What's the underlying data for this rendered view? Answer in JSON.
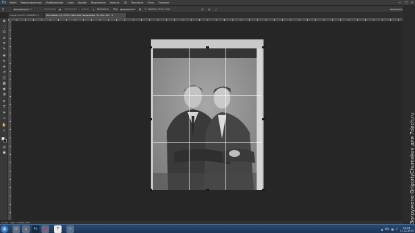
{
  "app": {
    "logo": "Ps",
    "menu": [
      "Файл",
      "Редактирование",
      "Изображение",
      "Слои",
      "Шрифт",
      "Выделение",
      "Фильтр",
      "3D",
      "Просмотр",
      "Окно",
      "Справка"
    ],
    "window_controls": [
      "—",
      "❐",
      "✕"
    ]
  },
  "options": {
    "preset_value": "Произвольно",
    "straighten_label": "Выпрямить",
    "view_label": "Вид",
    "view_value": "Правило 1/3",
    "delete_cropped_label": "Удалить отсеч. пикс.",
    "right_dropdown": "Основная рабочая среда"
  },
  "tabs": [
    {
      "label": "Image @ 6,25% (RGB/8#) ×",
      "active": false
    },
    {
      "label": "Без имени-1 @ 12,5% (Фрагмент выделения, Тр.слоя, RG... ×",
      "active": true
    }
  ],
  "toolbar": {
    "tools": [
      "move-icon",
      "marquee-icon",
      "lasso-icon",
      "quick-select-icon",
      "crop-icon",
      "eyedropper-icon",
      "healing-icon",
      "brush-icon",
      "stamp-icon",
      "history-brush-icon",
      "eraser-icon",
      "gradient-icon",
      "blur-icon",
      "dodge-icon",
      "pen-icon",
      "type-icon",
      "path-select-icon",
      "shape-icon",
      "hand-icon",
      "zoom-icon"
    ],
    "glyphs": [
      "✥",
      "⬚",
      "ʘ",
      "⌀",
      "⌗",
      "✎",
      "✚",
      "✎",
      "⎈",
      "↺",
      "◫",
      "▦",
      "◉",
      "◔",
      "✒",
      "T",
      "➤",
      "▭",
      "✋",
      "⌕"
    ],
    "fg_color": "#f2f2f2",
    "bg_color": "#111111"
  },
  "status": {
    "zoom": "12,5%",
    "doc_info": "Док: 11,9M/11,9M"
  },
  "watermark": "Загружено GrigoriyChumakov для 7dach.ru",
  "taskbar": {
    "clock_time": "17:28",
    "clock_date": "11.12.2014",
    "lang": "RU",
    "apps": [
      {
        "icon": "explorer-icon",
        "glyph": "▤",
        "color": "#e8c65a"
      },
      {
        "icon": "vlc-icon",
        "glyph": "▲",
        "color": "#f08a1c"
      },
      {
        "icon": "photoshop-icon",
        "glyph": "Ps",
        "color": "#4ca3e6"
      },
      {
        "icon": "opera-icon",
        "glyph": "O",
        "color": "#e2352a"
      },
      {
        "icon": "yandex-icon",
        "glyph": "Y",
        "color": "#e23d3d"
      },
      {
        "icon": "chrome-icon",
        "glyph": "◉",
        "color": "#5fa1ea"
      }
    ]
  }
}
